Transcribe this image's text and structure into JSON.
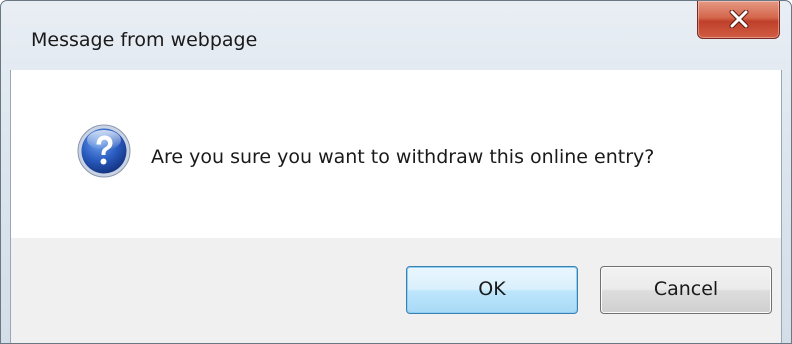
{
  "dialog": {
    "title": "Message from webpage",
    "message": "Are you sure you want to withdraw this online entry?",
    "icon": "question-icon",
    "close_icon": "close-icon",
    "buttons": {
      "ok_label": "OK",
      "cancel_label": "Cancel"
    }
  },
  "colors": {
    "icon_blue": "#1f4fa8",
    "close_red": "#c0402a",
    "ok_border": "#3c7fb1"
  }
}
